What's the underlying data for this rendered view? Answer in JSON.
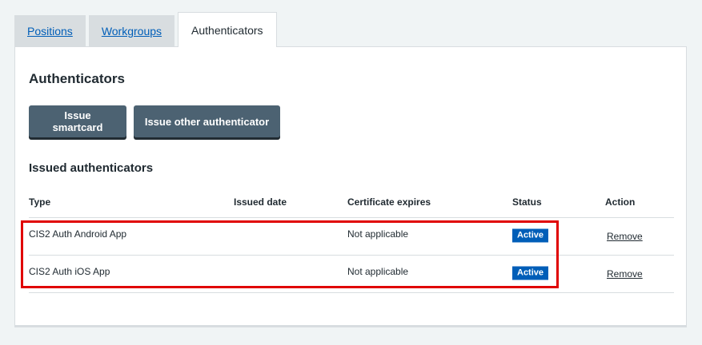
{
  "tabs": [
    {
      "label": "Positions",
      "active": false
    },
    {
      "label": "Workgroups",
      "active": false
    },
    {
      "label": "Authenticators",
      "active": true
    }
  ],
  "panel": {
    "heading": "Authenticators",
    "buttons": {
      "issue_smartcard": "Issue smartcard",
      "issue_other": "Issue other authenticator"
    },
    "subheading": "Issued authenticators"
  },
  "table": {
    "columns": [
      "Type",
      "Issued date",
      "Certificate expires",
      "Status",
      "Action"
    ],
    "rows": [
      {
        "type": "CIS2 Auth Android App",
        "issued": "",
        "cert": "Not applicable",
        "status": "Active",
        "action": "Remove"
      },
      {
        "type": "CIS2 Auth iOS App",
        "issued": "",
        "cert": "Not applicable",
        "status": "Active",
        "action": "Remove"
      }
    ]
  },
  "colors": {
    "background": "#f0f4f5",
    "tab_inactive": "#d8dde0",
    "link": "#005eb8",
    "button": "#4c6272",
    "badge": "#005eb8",
    "highlight": "#e00000"
  }
}
